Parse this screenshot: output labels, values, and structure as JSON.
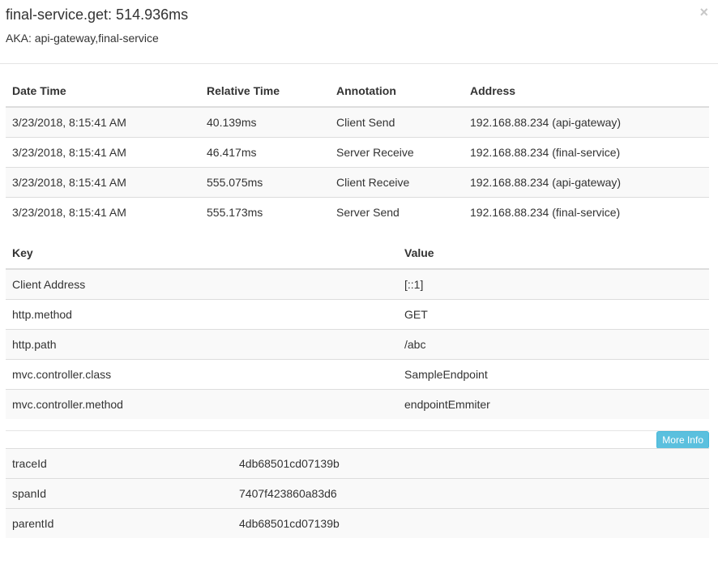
{
  "header": {
    "title": "final-service.get: 514.936ms",
    "aka": "AKA: api-gateway,final-service",
    "close_glyph": "×"
  },
  "annotations": {
    "columns": [
      "Date Time",
      "Relative Time",
      "Annotation",
      "Address"
    ],
    "rows": [
      [
        "3/23/2018, 8:15:41 AM",
        "40.139ms",
        "Client Send",
        "192.168.88.234 (api-gateway)"
      ],
      [
        "3/23/2018, 8:15:41 AM",
        "46.417ms",
        "Server Receive",
        "192.168.88.234 (final-service)"
      ],
      [
        "3/23/2018, 8:15:41 AM",
        "555.075ms",
        "Client Receive",
        "192.168.88.234 (api-gateway)"
      ],
      [
        "3/23/2018, 8:15:41 AM",
        "555.173ms",
        "Server Send",
        "192.168.88.234 (final-service)"
      ]
    ]
  },
  "binary_annotations": {
    "columns": [
      "Key",
      "Value"
    ],
    "rows": [
      [
        "Client Address",
        "[::1]"
      ],
      [
        "http.method",
        "GET"
      ],
      [
        "http.path",
        "/abc"
      ],
      [
        "mvc.controller.class",
        "SampleEndpoint"
      ],
      [
        "mvc.controller.method",
        "endpointEmmiter"
      ]
    ]
  },
  "more_info": {
    "label": "More Info"
  },
  "ids": {
    "rows": [
      [
        "traceId",
        "4db68501cd07139b"
      ],
      [
        "spanId",
        "7407f423860a83d6"
      ],
      [
        "parentId",
        "4db68501cd07139b"
      ]
    ]
  }
}
